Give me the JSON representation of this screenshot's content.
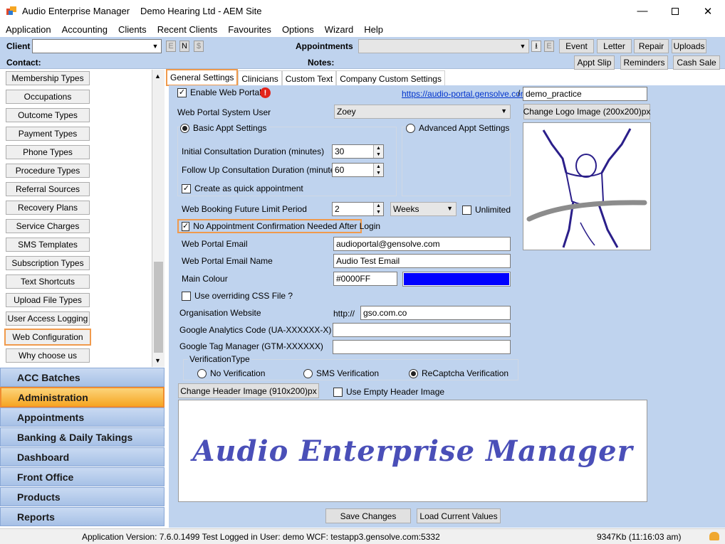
{
  "window": {
    "app_title": "Audio Enterprise Manager",
    "site_title": "Demo Hearing Ltd - AEM Site"
  },
  "menu": [
    "Application",
    "Accounting",
    "Clients",
    "Recent Clients",
    "Favourites",
    "Options",
    "Wizard",
    "Help"
  ],
  "toolbar": {
    "client_label": "Client",
    "contact_label": "Contact:",
    "appointments_label": "Appointments",
    "notes_label": "Notes:",
    "e_btn": "E",
    "n_btn": "N",
    "dollar_btn": "$",
    "e2_btn": "E",
    "event": "Event",
    "letter": "Letter",
    "repair": "Repair",
    "uploads": "Uploads",
    "appt_slip": "Appt Slip",
    "reminders": "Reminders",
    "cash_sale": "Cash Sale"
  },
  "sidebar": {
    "list": [
      "Membership Types",
      "Occupations",
      "Outcome Types",
      "Payment Types",
      "Phone Types",
      "Procedure Types",
      "Referral Sources",
      "Recovery Plans",
      "Service Charges",
      "SMS Templates",
      "Subscription Types",
      "Text Shortcuts",
      "Upload File Types",
      "User Access Logging",
      "Web Configuration",
      "Why choose us"
    ],
    "nav": [
      "ACC Batches",
      "Administration",
      "Appointments",
      "Banking & Daily Takings",
      "Dashboard",
      "Front Office",
      "Products",
      "Reports"
    ]
  },
  "tabs": [
    "General Settings",
    "Clinicians",
    "Custom Text",
    "Company Custom Settings"
  ],
  "form": {
    "enable_web_portal": "Enable Web Portal",
    "portal_link": "https://audio-portal.gensolve.com",
    "slash": "/",
    "practice_value": "demo_practice",
    "system_user_label": "Web Portal System User",
    "system_user_value": "Zoey",
    "change_logo": "Change Logo Image (200x200)px",
    "basic_appt": "Basic Appt Settings",
    "advanced_appt": "Advanced Appt Settings",
    "initial_label": "Initial Consultation Duration (minutes)",
    "initial_value": "30",
    "followup_label": "Follow Up Consultation Duration (minutes)",
    "followup_value": "60",
    "quick_appt": "Create as quick appointment",
    "booking_label": "Web Booking Future Limit Period",
    "booking_value": "2",
    "booking_unit": "Weeks",
    "unlimited": "Unlimited",
    "no_confirm": "No Appointment Confirmation Needed After Login",
    "email_label": "Web Portal Email",
    "email_value": "audioportal@gensolve.com",
    "email_name_label": "Web Portal Email Name",
    "email_name_value": "Audio Test Email",
    "main_colour_label": "Main Colour",
    "main_colour_value": "#0000FF",
    "css_label": "Use overriding CSS File ?",
    "org_site_label": "Organisation Website",
    "http_prefix": "http://",
    "org_site_value": "gso.com.co",
    "ga_label": "Google Analytics Code (UA-XXXXXX-X)",
    "gtm_label": "Google Tag Manager (GTM-XXXXXX)",
    "verif_title": "VerificationType",
    "verif_none": "No Verification",
    "verif_sms": "SMS Verification",
    "verif_recaptcha": "ReCaptcha Verification",
    "change_header": "Change Header Image (910x200)px",
    "empty_header": "Use Empty Header Image",
    "header_text": "Audio Enterprise Manager",
    "save": "Save Changes",
    "load": "Load Current Values"
  },
  "status": {
    "left": "Application Version: 7.6.0.1499 Test  Logged in User: demo WCF: testapp3.gensolve.com:5332",
    "memory": "9347Kb  (11:16:03 am)"
  },
  "colors": {
    "accent": "#0000FF",
    "nav_active": "#f6a623",
    "panel": "#bfd3ee"
  }
}
